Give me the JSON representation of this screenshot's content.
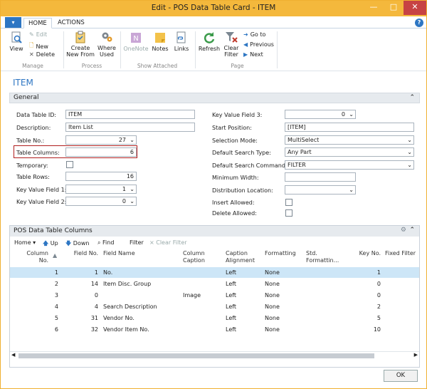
{
  "window": {
    "title": "Edit - POS Data Table Card - ITEM",
    "minimize": "—",
    "maximize": "□",
    "close": "✕"
  },
  "tabs": {
    "app_menu": "▾",
    "home": "HOME",
    "actions": "ACTIONS",
    "help": "?"
  },
  "ribbon": {
    "manage": {
      "view": "View",
      "edit": "Edit",
      "new": "New",
      "delete": "Delete",
      "group": "Manage"
    },
    "process": {
      "create_new_from_1": "Create",
      "create_new_from_2": "New From",
      "where_used_1": "Where",
      "where_used_2": "Used",
      "group": "Process"
    },
    "attached": {
      "onenote": "OneNote",
      "notes": "Notes",
      "links": "Links",
      "group": "Show Attached"
    },
    "page": {
      "refresh": "Refresh",
      "clear_filter_1": "Clear",
      "clear_filter_2": "Filter",
      "goto": "Go to",
      "previous": "Previous",
      "next": "Next",
      "group": "Page"
    }
  },
  "page_title": "ITEM",
  "general": {
    "header": "General",
    "data_table_id": {
      "label": "Data Table ID:",
      "value": "ITEM"
    },
    "description": {
      "label": "Description:",
      "value": "Item List"
    },
    "table_no": {
      "label": "Table No.:",
      "value": "27"
    },
    "table_columns": {
      "label": "Table Columns:",
      "value": "6"
    },
    "temporary": {
      "label": "Temporary:"
    },
    "table_rows": {
      "label": "Table Rows:",
      "value": "16"
    },
    "key_value_field_1": {
      "label": "Key Value Field 1:",
      "value": "1"
    },
    "key_value_field_2": {
      "label": "Key Value Field 2:",
      "value": "0"
    },
    "key_value_field_3": {
      "label": "Key Value Field 3:",
      "value": "0"
    },
    "start_position": {
      "label": "Start Position:",
      "value": "[ITEM]"
    },
    "selection_mode": {
      "label": "Selection Mode:",
      "value": "MultiSelect"
    },
    "default_search_type": {
      "label": "Default Search Type:",
      "value": "Any Part"
    },
    "default_search_command": {
      "label": "Default Search Command:",
      "value": "FILTER"
    },
    "minimum_width": {
      "label": "Minimum Width:",
      "value": ""
    },
    "distribution_location": {
      "label": "Distribution Location:",
      "value": ""
    },
    "insert_allowed": {
      "label": "Insert Allowed:"
    },
    "delete_allowed": {
      "label": "Delete Allowed:"
    }
  },
  "columns_part": {
    "header": "POS Data Table Columns",
    "toolbar": {
      "home": "Home",
      "up": "Up",
      "down": "Down",
      "find": "Find",
      "filter": "Filter",
      "clear_filter": "Clear Filter"
    },
    "headers": {
      "column_no_1": "Column",
      "column_no_2": "No.",
      "field_no": "Field No.",
      "field_name": "Field Name",
      "column_caption_1": "Column",
      "column_caption_2": "Caption",
      "caption_alignment_1": "Caption",
      "caption_alignment_2": "Alignment",
      "formatting": "Formatting",
      "std_formatting_1": "Std.",
      "std_formatting_2": "Formattin...",
      "key_no": "Key No.",
      "fixed_filter": "Fixed Filter"
    },
    "rows": [
      {
        "column_no": "1",
        "field_no": "1",
        "field_name": "No.",
        "caption": "",
        "alignment": "Left",
        "formatting": "None",
        "key_no": "1"
      },
      {
        "column_no": "2",
        "field_no": "14",
        "field_name": "Item Disc. Group",
        "caption": "",
        "alignment": "Left",
        "formatting": "None",
        "key_no": "0"
      },
      {
        "column_no": "3",
        "field_no": "0",
        "field_name": "",
        "caption": "Image",
        "alignment": "Left",
        "formatting": "None",
        "key_no": "0"
      },
      {
        "column_no": "4",
        "field_no": "4",
        "field_name": "Search Description",
        "caption": "",
        "alignment": "Left",
        "formatting": "None",
        "key_no": "2"
      },
      {
        "column_no": "5",
        "field_no": "31",
        "field_name": "Vendor No.",
        "caption": "",
        "alignment": "Left",
        "formatting": "None",
        "key_no": "5"
      },
      {
        "column_no": "6",
        "field_no": "32",
        "field_name": "Vendor Item No.",
        "caption": "",
        "alignment": "Left",
        "formatting": "None",
        "key_no": "10"
      }
    ]
  },
  "ok_label": "OK"
}
